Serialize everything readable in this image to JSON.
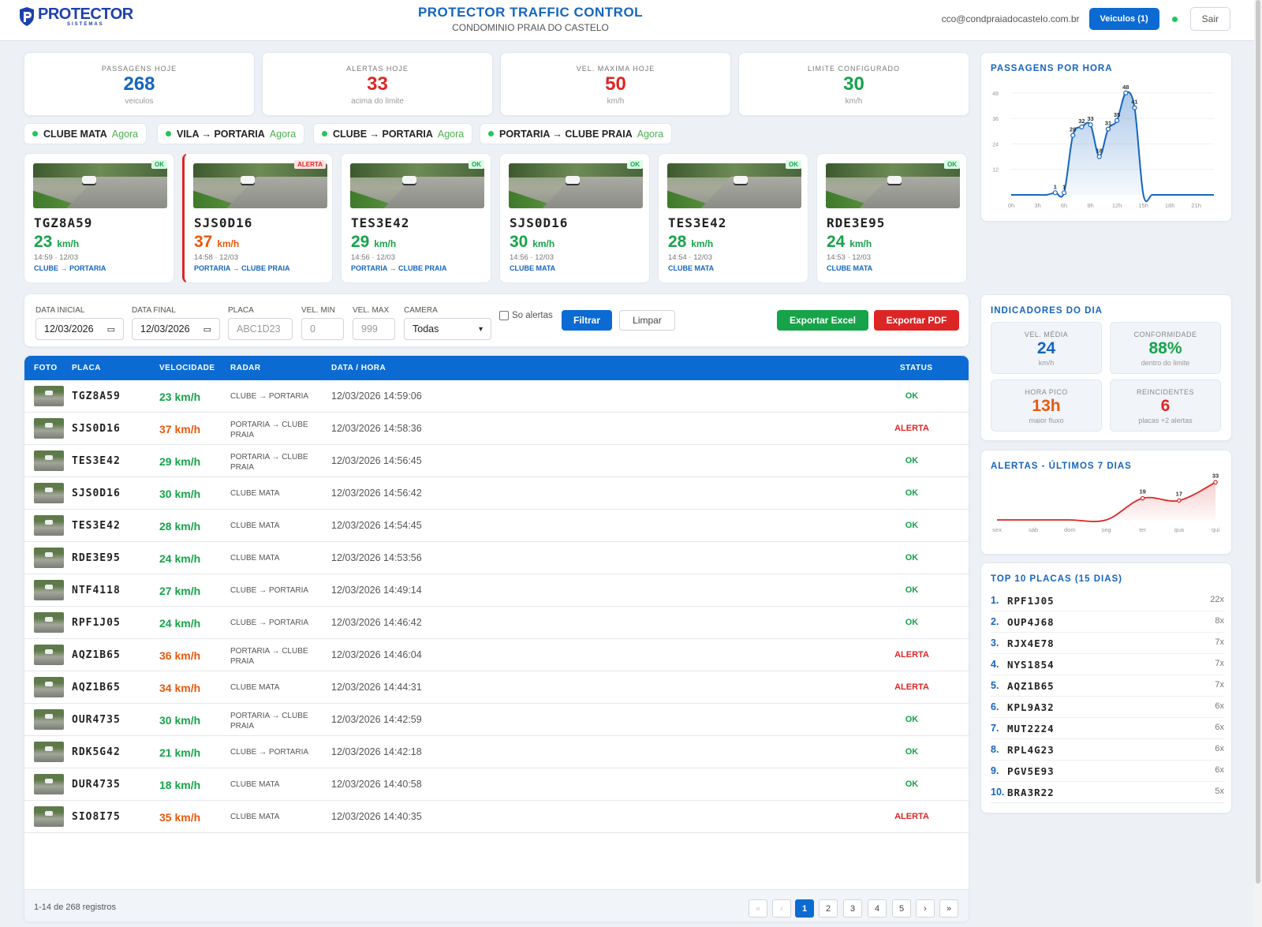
{
  "header": {
    "logo_main": "PROTECTOR",
    "logo_sub": "SISTEMAS",
    "title": "PROTECTOR TRAFFIC CONTROL",
    "subtitle": "CONDOMINIO PRAIA DO CASTELO",
    "email": "cco@condpraiadocastelo.com.br",
    "vehicles_button": "Veiculos (1)",
    "logout_button": "Sair"
  },
  "stats": [
    {
      "label": "PASSAGENS HOJE",
      "value": "268",
      "unit": "veiculos",
      "color": "#1565c0"
    },
    {
      "label": "ALERTAS HOJE",
      "value": "33",
      "unit": "acima do limite",
      "color": "#dc2626"
    },
    {
      "label": "VEL. MAXIMA HOJE",
      "value": "50",
      "unit": "km/h",
      "color": "#dc2626"
    },
    {
      "label": "LIMITE CONFIGURADO",
      "value": "30",
      "unit": "km/h",
      "color": "#16a34a"
    }
  ],
  "radars": [
    {
      "name": "CLUBE MATA",
      "status": "Agora"
    },
    {
      "name": "VILA → PORTARIA",
      "status": "Agora"
    },
    {
      "name": "CLUBE → PORTARIA",
      "status": "Agora"
    },
    {
      "name": "PORTARIA → CLUBE PRAIA",
      "status": "Agora"
    }
  ],
  "cameras": [
    {
      "plate": "TGZ8A59",
      "speed": "23",
      "unit": "km/h",
      "time": "14:59 · 12/03",
      "route": "CLUBE → PORTARIA",
      "badge": "OK"
    },
    {
      "plate": "SJS0D16",
      "speed": "37",
      "unit": "km/h",
      "time": "14:58 · 12/03",
      "route": "PORTARIA → CLUBE PRAIA",
      "badge": "ALERTA"
    },
    {
      "plate": "TES3E42",
      "speed": "29",
      "unit": "km/h",
      "time": "14:56 · 12/03",
      "route": "PORTARIA → CLUBE PRAIA",
      "badge": "OK"
    },
    {
      "plate": "SJS0D16",
      "speed": "30",
      "unit": "km/h",
      "time": "14:56 · 12/03",
      "route": "CLUBE MATA",
      "badge": "OK"
    },
    {
      "plate": "TES3E42",
      "speed": "28",
      "unit": "km/h",
      "time": "14:54 · 12/03",
      "route": "CLUBE MATA",
      "badge": "OK"
    },
    {
      "plate": "RDE3E95",
      "speed": "24",
      "unit": "km/h",
      "time": "14:53 · 12/03",
      "route": "CLUBE MATA",
      "badge": "OK"
    }
  ],
  "filters": {
    "start_label": "DATA INICIAL",
    "start_value": "12/03/2026",
    "end_label": "DATA FINAL",
    "end_value": "12/03/2026",
    "plate_label": "PLACA",
    "plate_placeholder": "ABC1D23",
    "vmin_label": "VEL. MIN",
    "vmin_placeholder": "0",
    "vmax_label": "VEL. MAX",
    "vmax_placeholder": "999",
    "camera_label": "CAMERA",
    "camera_value": "Todas",
    "alerts_only_label": "So alertas",
    "filter_button": "Filtrar",
    "clear_button": "Limpar",
    "excel_button": "Exportar Excel",
    "pdf_button": "Exportar PDF"
  },
  "table": {
    "headers": [
      "FOTO",
      "PLACA",
      "VELOCIDADE",
      "RADAR",
      "DATA / HORA",
      "STATUS"
    ],
    "rows": [
      {
        "plate": "TGZ8A59",
        "speed": "23 km/h",
        "radar": "CLUBE → PORTARIA",
        "datetime": "12/03/2026 14:59:06",
        "status": "OK"
      },
      {
        "plate": "SJS0D16",
        "speed": "37 km/h",
        "radar": "PORTARIA → CLUBE PRAIA",
        "datetime": "12/03/2026 14:58:36",
        "status": "ALERTA"
      },
      {
        "plate": "TES3E42",
        "speed": "29 km/h",
        "radar": "PORTARIA → CLUBE PRAIA",
        "datetime": "12/03/2026 14:56:45",
        "status": "OK"
      },
      {
        "plate": "SJS0D16",
        "speed": "30 km/h",
        "radar": "CLUBE MATA",
        "datetime": "12/03/2026 14:56:42",
        "status": "OK"
      },
      {
        "plate": "TES3E42",
        "speed": "28 km/h",
        "radar": "CLUBE MATA",
        "datetime": "12/03/2026 14:54:45",
        "status": "OK"
      },
      {
        "plate": "RDE3E95",
        "speed": "24 km/h",
        "radar": "CLUBE MATA",
        "datetime": "12/03/2026 14:53:56",
        "status": "OK"
      },
      {
        "plate": "NTF4118",
        "speed": "27 km/h",
        "radar": "CLUBE → PORTARIA",
        "datetime": "12/03/2026 14:49:14",
        "status": "OK"
      },
      {
        "plate": "RPF1J05",
        "speed": "24 km/h",
        "radar": "CLUBE → PORTARIA",
        "datetime": "12/03/2026 14:46:42",
        "status": "OK"
      },
      {
        "plate": "AQZ1B65",
        "speed": "36 km/h",
        "radar": "PORTARIA → CLUBE PRAIA",
        "datetime": "12/03/2026 14:46:04",
        "status": "ALERTA"
      },
      {
        "plate": "AQZ1B65",
        "speed": "34 km/h",
        "radar": "CLUBE MATA",
        "datetime": "12/03/2026 14:44:31",
        "status": "ALERTA"
      },
      {
        "plate": "OUR4735",
        "speed": "30 km/h",
        "radar": "PORTARIA → CLUBE PRAIA",
        "datetime": "12/03/2026 14:42:59",
        "status": "OK"
      },
      {
        "plate": "RDK5G42",
        "speed": "21 km/h",
        "radar": "CLUBE → PORTARIA",
        "datetime": "12/03/2026 14:42:18",
        "status": "OK"
      },
      {
        "plate": "DUR4735",
        "speed": "18 km/h",
        "radar": "CLUBE MATA",
        "datetime": "12/03/2026 14:40:58",
        "status": "OK"
      },
      {
        "plate": "SIO8I75",
        "speed": "35 km/h",
        "radar": "CLUBE MATA",
        "datetime": "12/03/2026 14:40:35",
        "status": "ALERTA"
      }
    ],
    "footer_count": "1-14 de 268 registros",
    "pagination": [
      "«",
      "‹",
      "1",
      "2",
      "3",
      "4",
      "5",
      "›",
      "»"
    ],
    "current_page": "1"
  },
  "hourly_chart": {
    "title": "PASSAGENS POR HORA",
    "type": "area",
    "x": [
      0,
      1,
      2,
      3,
      4,
      5,
      6,
      7,
      8,
      9,
      10,
      11,
      12,
      13,
      14,
      15,
      16,
      17,
      18,
      19,
      20,
      21,
      22,
      23
    ],
    "values": [
      0,
      0,
      0,
      0,
      0,
      1,
      1,
      28,
      32,
      33,
      18,
      31,
      35,
      48,
      41,
      0,
      0,
      0,
      0,
      0,
      0,
      0,
      0,
      0
    ],
    "data_labels": [
      "1",
      "1",
      "28",
      "32",
      "33",
      "18",
      "31",
      "35",
      "48",
      "41"
    ],
    "xticks": [
      "0h",
      "3h",
      "6h",
      "9h",
      "12h",
      "15h",
      "18h",
      "21h"
    ],
    "yticks": [
      "12",
      "24",
      "36",
      "48"
    ],
    "ylim": [
      0,
      52
    ],
    "color": "#1565c0"
  },
  "indicators": {
    "title": "INDICADORES DO DIA",
    "items": [
      {
        "label": "VEL. MÉDIA",
        "value": "24",
        "unit": "km/h",
        "color": "#1565c0"
      },
      {
        "label": "CONFORMIDADE",
        "value": "88%",
        "unit": "dentro do limite",
        "color": "#16a34a"
      },
      {
        "label": "HORA PICO",
        "value": "13h",
        "unit": "maior fluxo",
        "color": "#ea580c"
      },
      {
        "label": "REINCIDENTES",
        "value": "6",
        "unit": "placas +2 alertas",
        "color": "#dc2626"
      }
    ]
  },
  "alerts_chart": {
    "title": "ALERTAS - ÚLTIMOS 7 DIAS",
    "type": "line",
    "categories": [
      "sex",
      "sáb",
      "dom",
      "seg",
      "ter",
      "qua",
      "qui"
    ],
    "values": [
      0,
      0,
      0,
      0,
      19,
      17,
      33
    ],
    "labels": [
      "19",
      "17",
      "33"
    ],
    "ylim": [
      0,
      36
    ],
    "color": "#dc2626"
  },
  "top_plates": {
    "title": "TOP 10 PLACAS (15 DIAS)",
    "items": [
      {
        "rank": "1.",
        "plate": "RPF1J05",
        "count": "22x"
      },
      {
        "rank": "2.",
        "plate": "OUP4J68",
        "count": "8x"
      },
      {
        "rank": "3.",
        "plate": "RJX4E78",
        "count": "7x"
      },
      {
        "rank": "4.",
        "plate": "NYS1854",
        "count": "7x"
      },
      {
        "rank": "5.",
        "plate": "AQZ1B65",
        "count": "7x"
      },
      {
        "rank": "6.",
        "plate": "KPL9A32",
        "count": "6x"
      },
      {
        "rank": "7.",
        "plate": "MUT2224",
        "count": "6x"
      },
      {
        "rank": "8.",
        "plate": "RPL4G23",
        "count": "6x"
      },
      {
        "rank": "9.",
        "plate": "PGV5E93",
        "count": "6x"
      },
      {
        "rank": "10.",
        "plate": "BRA3R22",
        "count": "5x"
      }
    ]
  }
}
